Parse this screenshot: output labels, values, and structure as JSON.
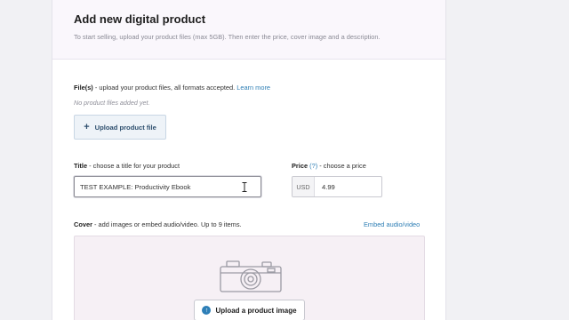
{
  "header": {
    "title": "Add new digital product",
    "subtitle": "To start selling, upload your product files (max 5GB). Then enter the price, cover image and a description."
  },
  "files": {
    "label_bold": "File(s)",
    "label_rest": " - upload your product files, all formats accepted. ",
    "learn_more": "Learn more",
    "empty_text": "No product files added yet.",
    "upload_button": "Upload product file",
    "upload_icon": "plus-icon"
  },
  "title_field": {
    "label_bold": "Title",
    "label_rest": " - choose a title for your product",
    "value": "TEST EXAMPLE: Productivity Ebook"
  },
  "price_field": {
    "label_bold": "Price",
    "help_link": "(?)",
    "label_rest": " - choose a price",
    "currency": "USD",
    "value": "4.99"
  },
  "cover": {
    "label_bold": "Cover",
    "label_rest": " - add images or embed audio/video. Up to 9 items.",
    "embed_link": "Embed audio/video",
    "upload_button": "Upload a product image",
    "placeholder_icon": "camera-icon"
  },
  "colors": {
    "link": "#2f7fb5",
    "upload_accent": "#2e7fb7",
    "cover_bg": "#f6f0f5"
  }
}
